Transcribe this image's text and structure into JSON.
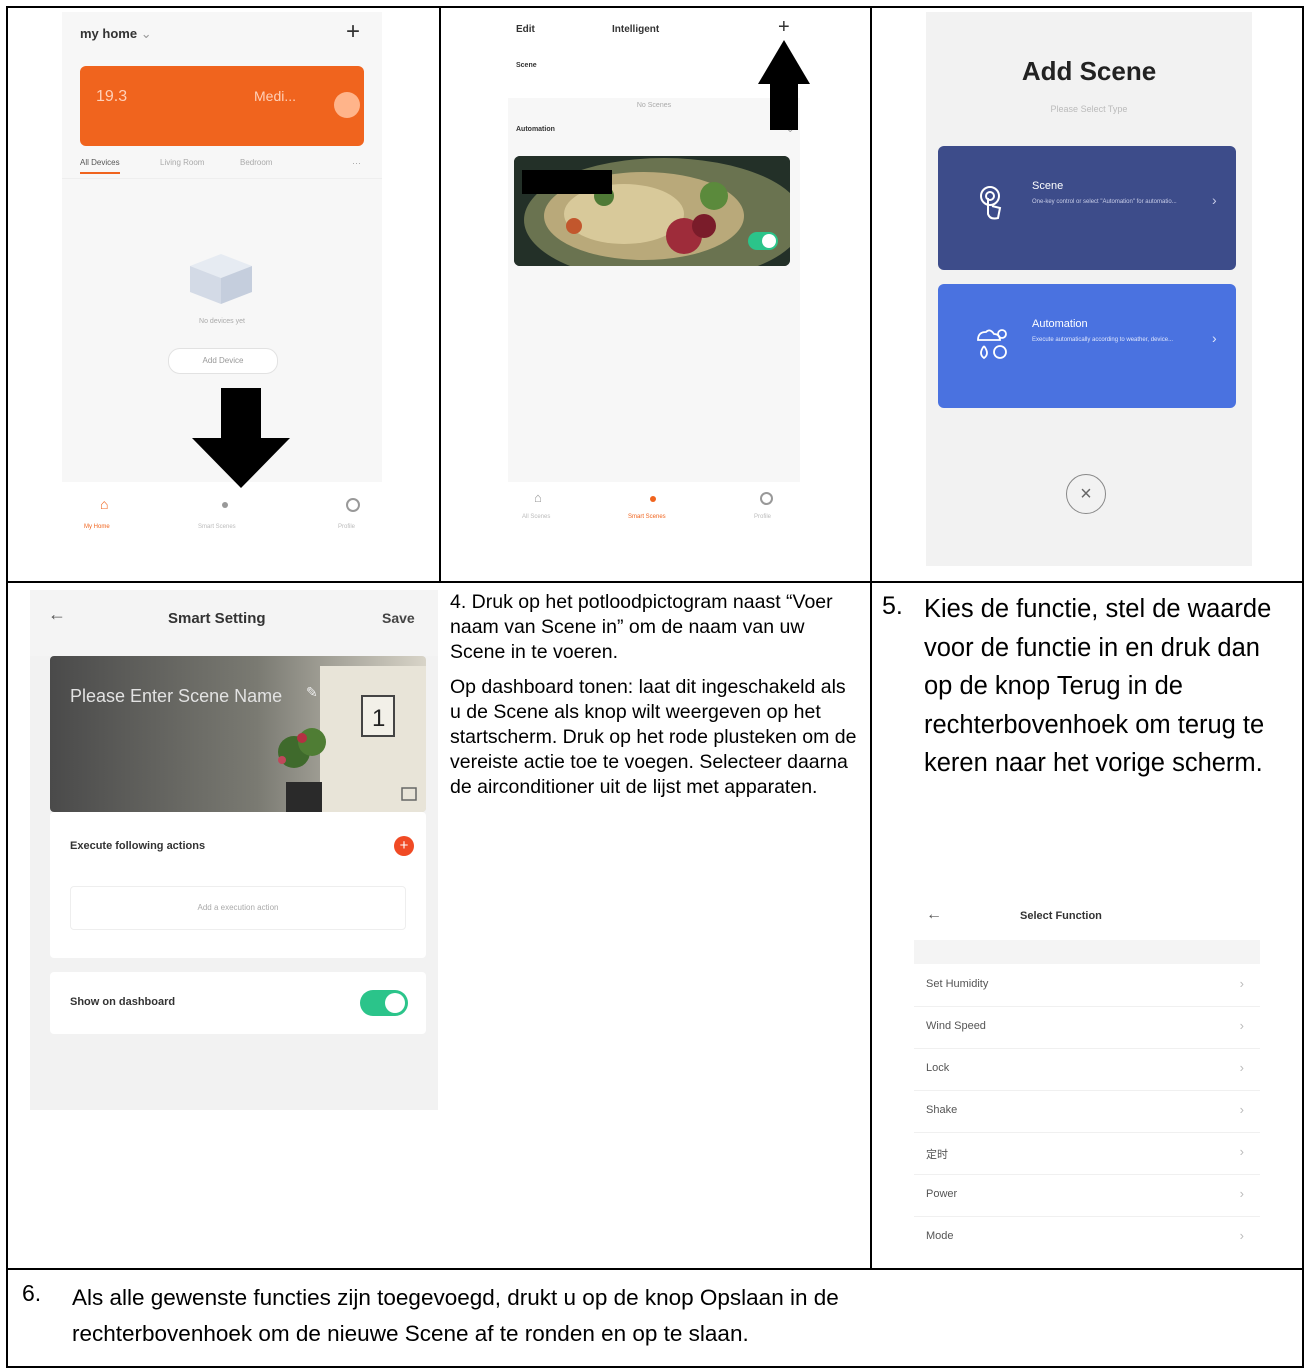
{
  "panel1": {
    "home_title": "my home",
    "temp": "19.3",
    "weather": "Medi...",
    "tabs": [
      "All Devices",
      "Living Room",
      "Bedroom"
    ],
    "empty_text": "No devices yet",
    "add_device": "Add Device",
    "nav": [
      "My Home",
      "Smart Scenes",
      "Profile"
    ]
  },
  "panel2": {
    "edit": "Edit",
    "title": "Intelligent",
    "scene_label": "Scene",
    "no_scenes": "No Scenes",
    "automation_label": "Automation",
    "nav": [
      "All Scenes",
      "Smart Scenes",
      "Profile"
    ]
  },
  "panel3": {
    "title": "Add Scene",
    "subtitle": "Please Select Type",
    "scene_card_title": "Scene",
    "scene_card_desc": "One-key control or select \"Automation\" for automatio...",
    "automation_card_title": "Automation",
    "automation_card_desc": "Execute automatically according to weather, device..."
  },
  "panel4": {
    "header_title": "Smart Setting",
    "save": "Save",
    "scene_name_placeholder": "Please Enter Scene Name",
    "execute_label": "Execute following actions",
    "add_action": "Add a execution action",
    "show_dashboard": "Show on dashboard"
  },
  "step4": {
    "p1": "4.     Druk op het potloodpictogram naast “Voer naam van Scene in” om de naam van uw Scene in te voeren.",
    "p2": "Op dashboard tonen: laat dit ingeschakeld als u de Scene als knop wilt weergeven op het startscherm. Druk op het rode plusteken om de vereiste actie toe te voegen. Selecteer daarna de airconditioner uit de lijst met apparaten."
  },
  "step5": {
    "number": "5.",
    "text": "Kies de functie, stel de waarde voor de functie in en druk dan op de knop Terug in de rechterbovenhoek om terug te keren naar het vorige scherm.",
    "select_title": "Select Function",
    "functions": [
      "Set Humidity",
      "Wind Speed",
      "Lock",
      "Shake",
      "定时",
      "Power",
      "Mode"
    ]
  },
  "step6": {
    "number": "6.",
    "line1": "Als alle gewenste functies zijn toegevoegd, drukt u op de knop Opslaan in de",
    "line2": "rechterbovenhoek om de nieuwe Scene af te ronden en op te slaan."
  },
  "colors": {
    "orange": "#f0641e",
    "scene_card": "#3d4c8a",
    "automation_card": "#4a72e0",
    "toggle": "#2bc48a",
    "add_red": "#f04a24"
  }
}
